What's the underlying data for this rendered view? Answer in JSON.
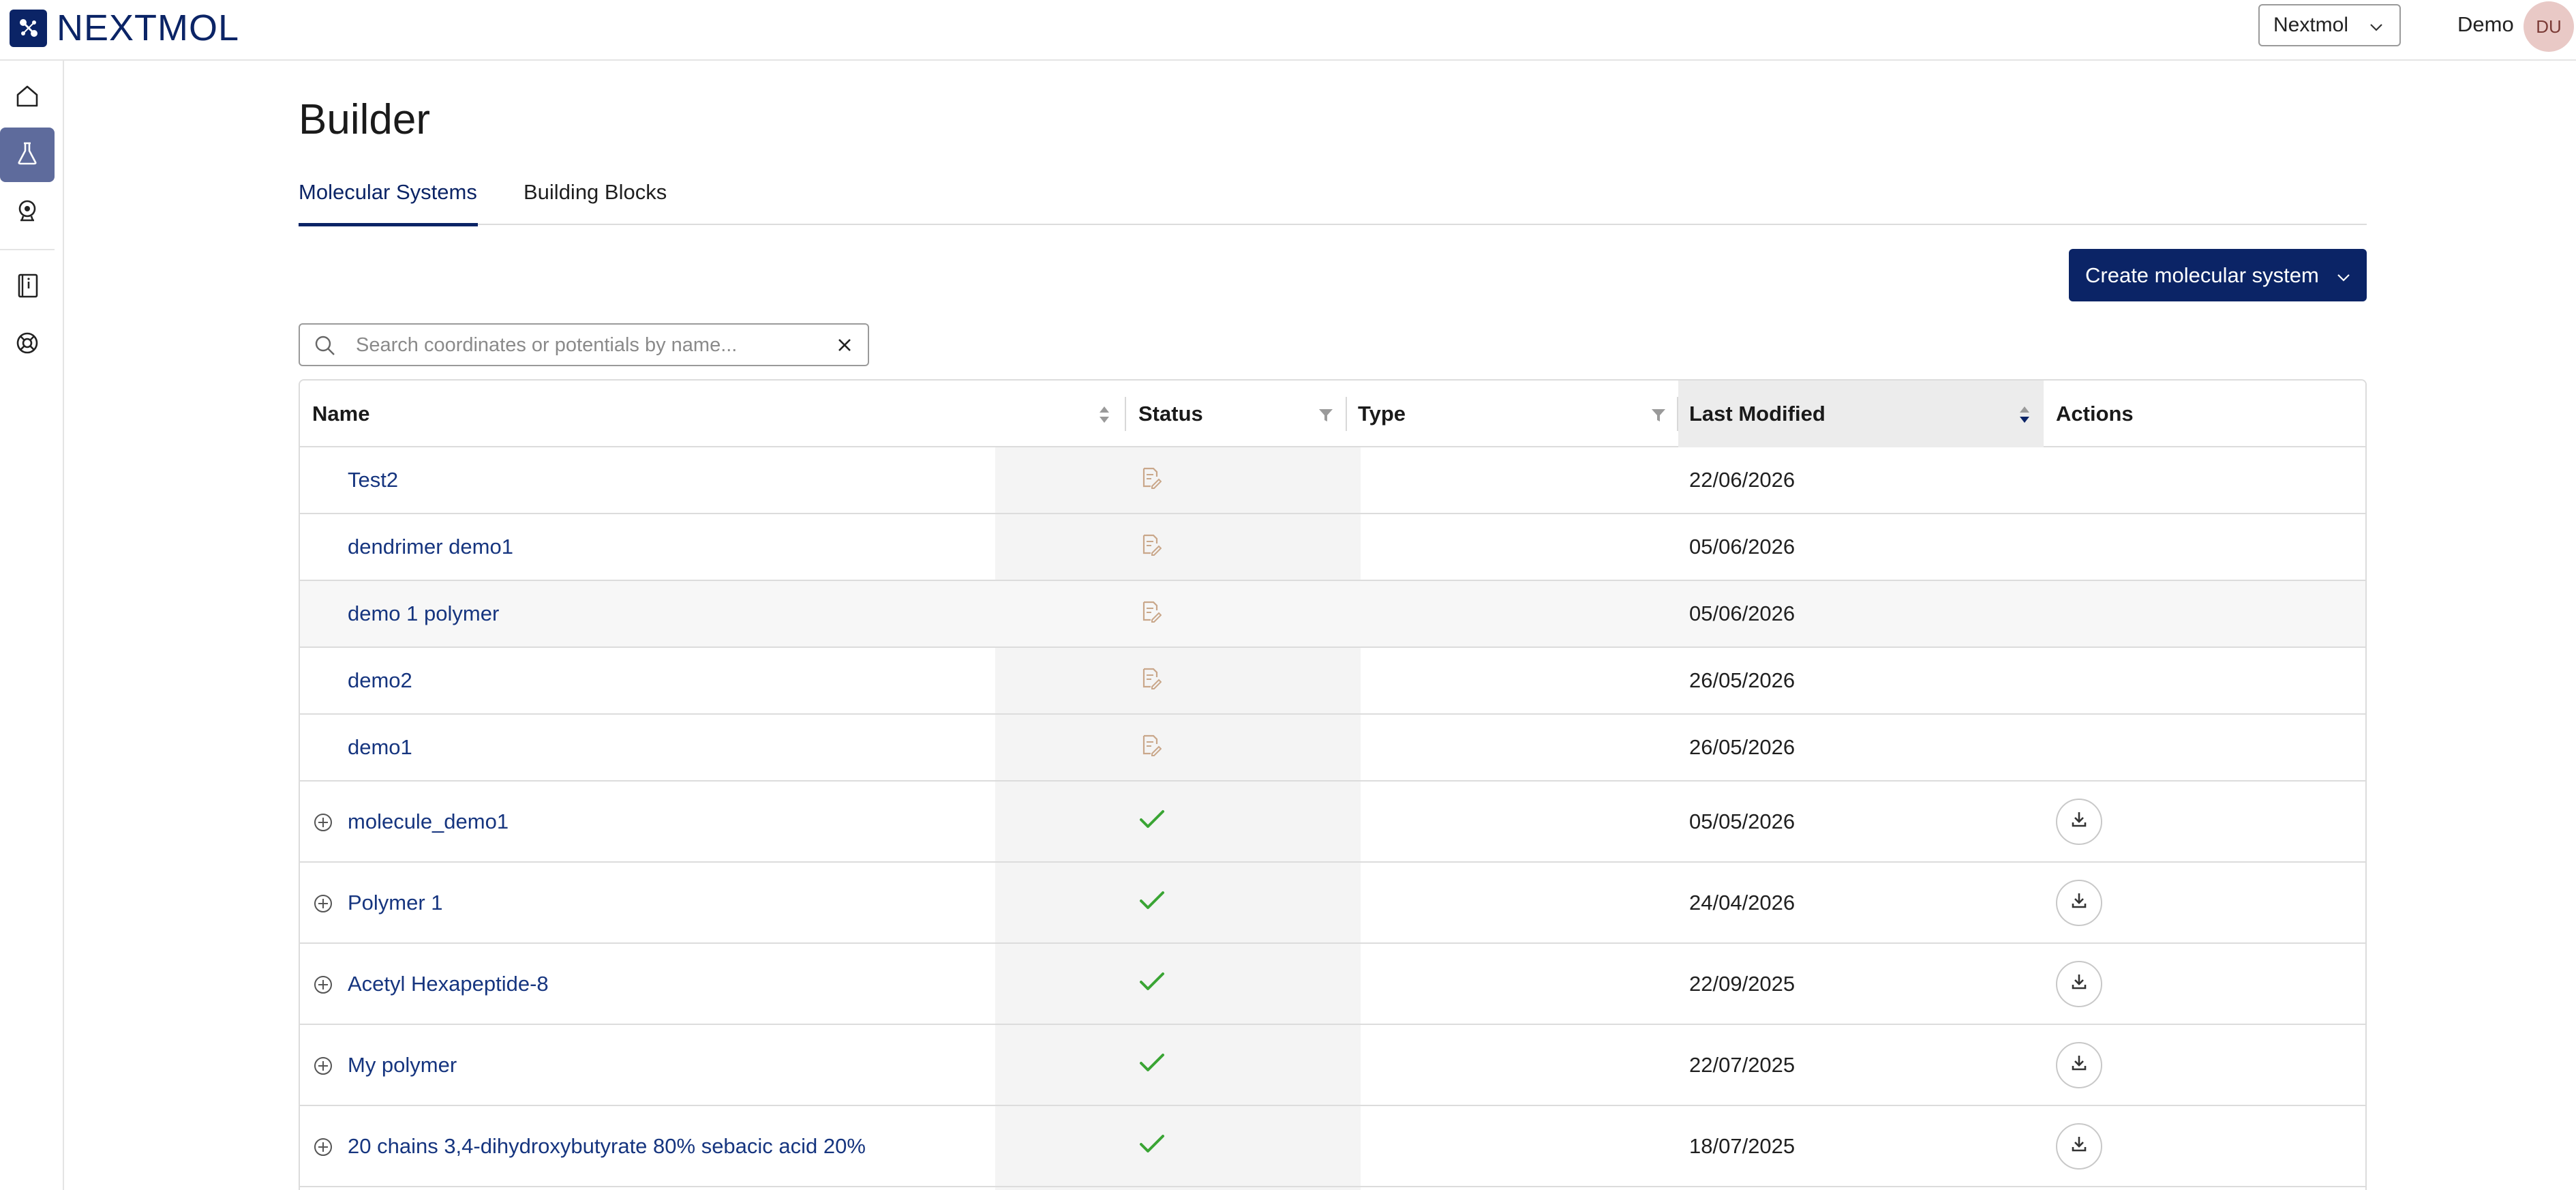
{
  "app": {
    "brand": "NEXTMOL",
    "accent_color": "#0b2466"
  },
  "topbar": {
    "org_select_value": "Nextmol",
    "user_name": "Demo",
    "user_initials": "DU"
  },
  "sidebar": {
    "items": [
      {
        "icon": "home-icon",
        "active": false
      },
      {
        "icon": "flask-icon",
        "active": true
      },
      {
        "icon": "molecule-viewer-icon",
        "active": false
      },
      {
        "icon": "documentation-icon",
        "active": false
      },
      {
        "icon": "support-lifebuoy-icon",
        "active": false
      }
    ]
  },
  "page": {
    "title": "Builder"
  },
  "tabs": [
    {
      "label": "Molecular Systems",
      "active": true
    },
    {
      "label": "Building Blocks",
      "active": false
    }
  ],
  "actions": {
    "create_label": "Create molecular system"
  },
  "search": {
    "placeholder": "Search coordinates or potentials by name...",
    "value": ""
  },
  "table": {
    "columns": {
      "name": "Name",
      "status": "Status",
      "type": "Type",
      "last_modified": "Last Modified",
      "actions": "Actions"
    },
    "rows": [
      {
        "name": "Test2",
        "status": "draft",
        "type": "",
        "last_modified": "22/06/2026",
        "expandable": false,
        "downloadable": false
      },
      {
        "name": "dendrimer demo1",
        "status": "draft",
        "type": "",
        "last_modified": "05/06/2026",
        "expandable": false,
        "downloadable": false
      },
      {
        "name": "demo 1 polymer",
        "status": "draft",
        "type": "",
        "last_modified": "05/06/2026",
        "expandable": false,
        "downloadable": false
      },
      {
        "name": "demo2",
        "status": "draft",
        "type": "",
        "last_modified": "26/05/2026",
        "expandable": false,
        "downloadable": false
      },
      {
        "name": "demo1",
        "status": "draft",
        "type": "",
        "last_modified": "26/05/2026",
        "expandable": false,
        "downloadable": false
      },
      {
        "name": "molecule_demo1",
        "status": "complete",
        "type": "",
        "last_modified": "05/05/2026",
        "expandable": true,
        "downloadable": true
      },
      {
        "name": "Polymer 1",
        "status": "complete",
        "type": "",
        "last_modified": "24/04/2026",
        "expandable": true,
        "downloadable": true
      },
      {
        "name": "Acetyl Hexapeptide-8",
        "status": "complete",
        "type": "",
        "last_modified": "22/09/2025",
        "expandable": true,
        "downloadable": true
      },
      {
        "name": "My polymer",
        "status": "complete",
        "type": "",
        "last_modified": "22/07/2025",
        "expandable": true,
        "downloadable": true
      },
      {
        "name": "20 chains 3,4-dihydroxybutyrate 80% sebacic acid 20%",
        "status": "complete",
        "type": "",
        "last_modified": "18/07/2025",
        "expandable": true,
        "downloadable": true
      }
    ]
  }
}
